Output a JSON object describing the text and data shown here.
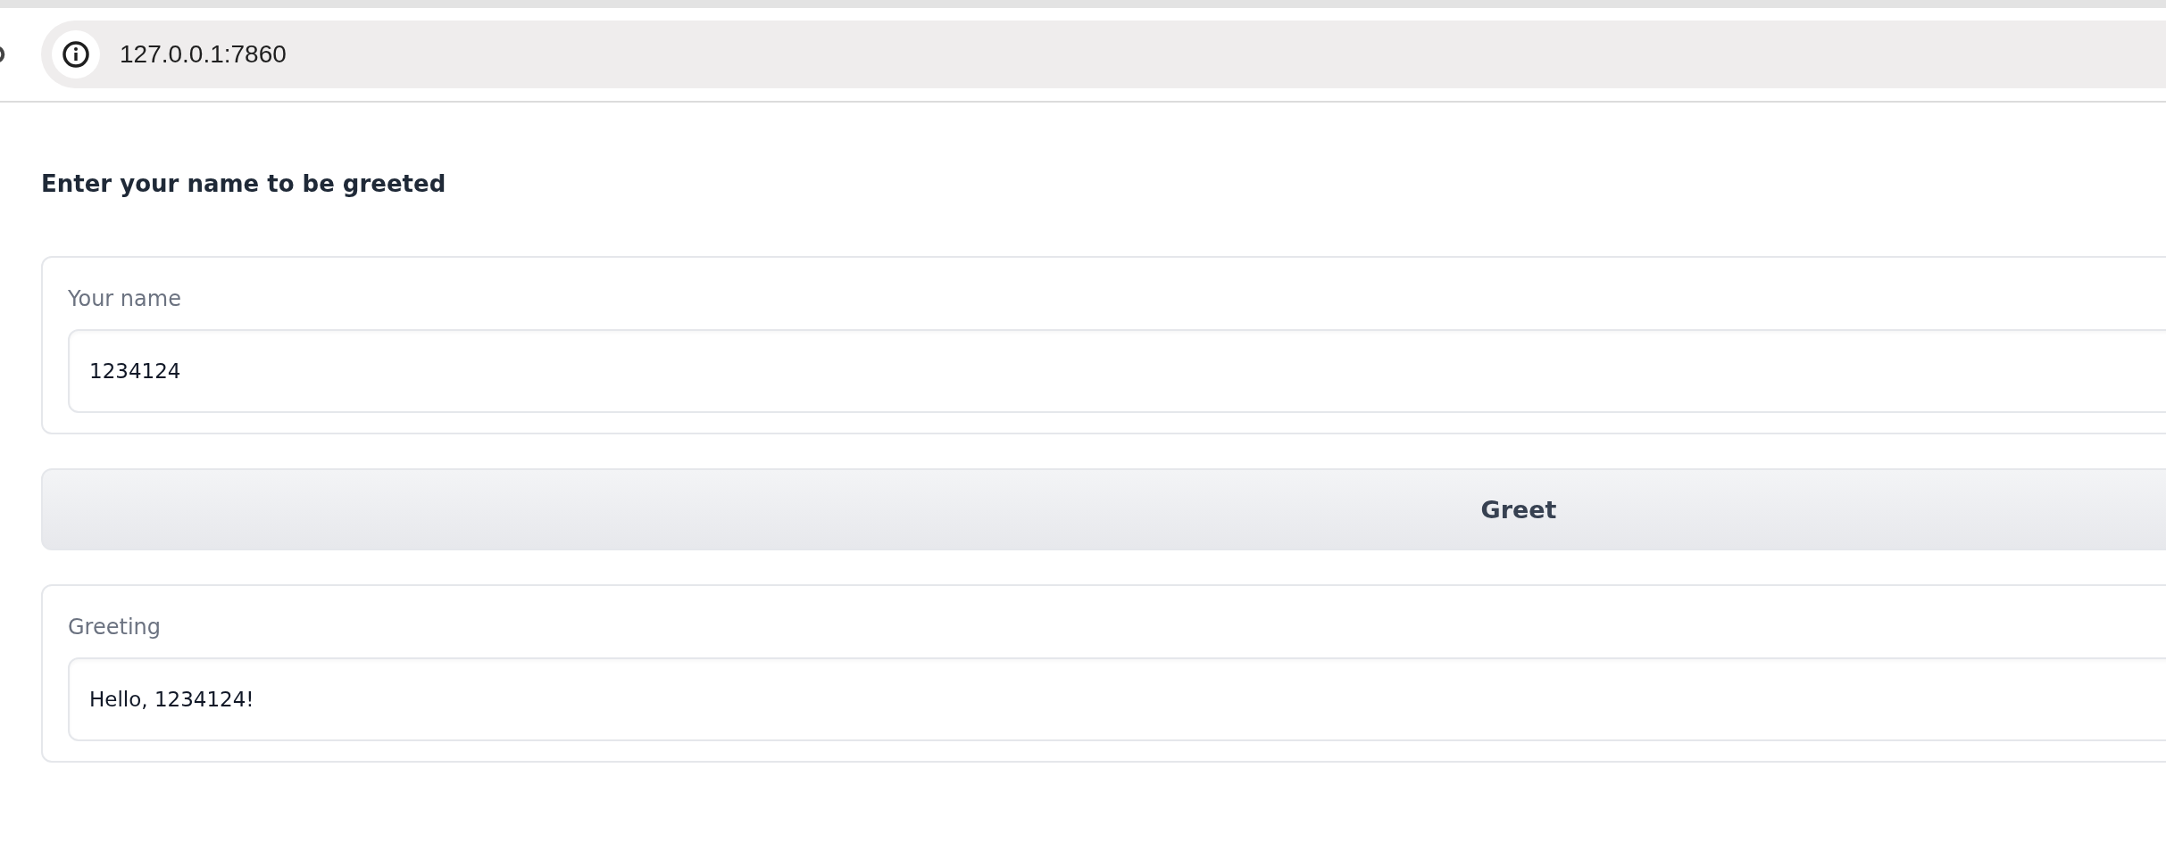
{
  "browser": {
    "url": "127.0.0.1:7860"
  },
  "heading": "Enter your name to be greeted",
  "name_field": {
    "label": "Your name",
    "value": "1234124"
  },
  "button": {
    "label": "Greet"
  },
  "output_field": {
    "label": "Greeting",
    "value": "Hello, 1234124!"
  }
}
